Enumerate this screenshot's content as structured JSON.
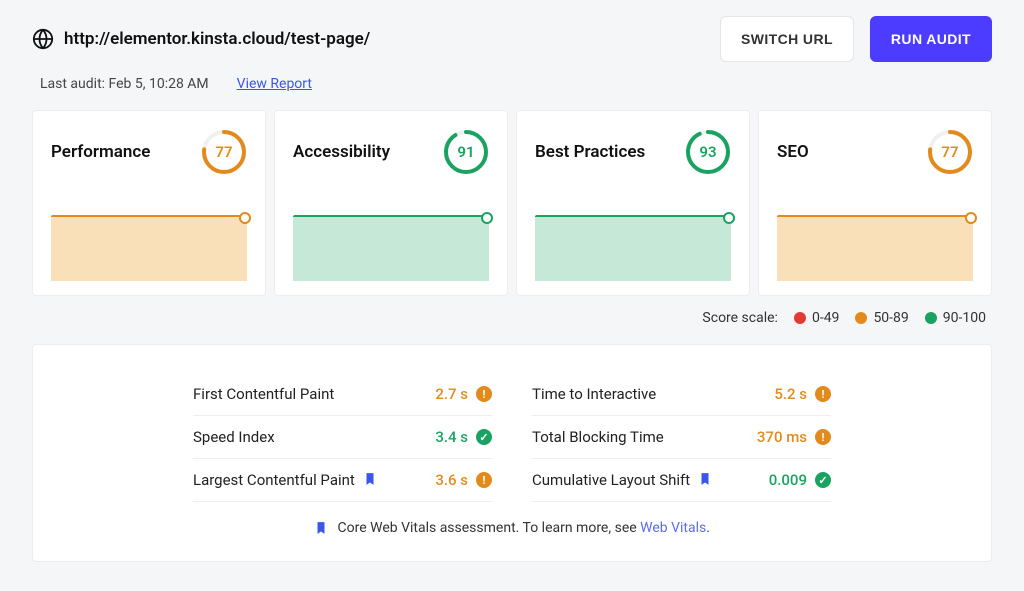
{
  "header": {
    "url": "http://elementor.kinsta.cloud/test-page/",
    "switch_label": "SWITCH URL",
    "run_label": "RUN AUDIT",
    "last_audit_label": "Last audit: Feb 5, 10:28 AM",
    "view_report_label": "View Report"
  },
  "cards": [
    {
      "title": "Performance",
      "score": "77",
      "tone": "orange"
    },
    {
      "title": "Accessibility",
      "score": "91",
      "tone": "green"
    },
    {
      "title": "Best Practices",
      "score": "93",
      "tone": "green"
    },
    {
      "title": "SEO",
      "score": "77",
      "tone": "orange"
    }
  ],
  "legend": {
    "label": "Score scale:",
    "bad": "0-49",
    "mid": "50-89",
    "good": "90-100"
  },
  "metrics": {
    "left": [
      {
        "name": "First Contentful Paint",
        "value": "2.7 s",
        "tone": "orange",
        "icon": "warn",
        "bookmark": false
      },
      {
        "name": "Speed Index",
        "value": "3.4 s",
        "tone": "green",
        "icon": "check",
        "bookmark": false
      },
      {
        "name": "Largest Contentful Paint",
        "value": "3.6 s",
        "tone": "orange",
        "icon": "warn",
        "bookmark": true
      }
    ],
    "right": [
      {
        "name": "Time to Interactive",
        "value": "5.2 s",
        "tone": "orange",
        "icon": "warn",
        "bookmark": false
      },
      {
        "name": "Total Blocking Time",
        "value": "370 ms",
        "tone": "orange",
        "icon": "warn",
        "bookmark": false
      },
      {
        "name": "Cumulative Layout Shift",
        "value": "0.009",
        "tone": "green",
        "icon": "check",
        "bookmark": true
      }
    ]
  },
  "footer": {
    "text_before": "Core Web Vitals assessment. To learn more, see ",
    "link_text": "Web Vitals",
    "text_after": "."
  },
  "colors": {
    "orange": "#e28a1b",
    "green": "#1aa260",
    "accent": "#4c3cff"
  }
}
